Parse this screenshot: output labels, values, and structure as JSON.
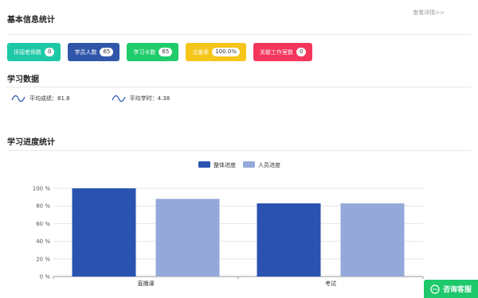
{
  "basic_info": {
    "title": "基本信息统计",
    "detail_link": "查看详情>>",
    "stats": [
      {
        "label": "评阅老师数",
        "value": "0",
        "color": "#1ec8a7"
      },
      {
        "label": "学员人数",
        "value": "65",
        "color": "#2f56a8"
      },
      {
        "label": "学习卡数",
        "value": "65",
        "color": "#1fcc6a"
      },
      {
        "label": "注册率",
        "value": "100.0%",
        "color": "#f5c518"
      },
      {
        "label": "关联工作室数",
        "value": "0",
        "color": "#f5365c"
      }
    ]
  },
  "study_data": {
    "title": "学习数据",
    "metrics": [
      {
        "label": "平均成绩：",
        "value": "81.8",
        "icon": "wave-icon"
      },
      {
        "label": "平均学时：",
        "value": "4.38",
        "icon": "wave-icon"
      }
    ]
  },
  "progress": {
    "title": "学习进度统计"
  },
  "chart_data": {
    "type": "bar",
    "categories": [
      "直播课",
      "考试"
    ],
    "series": [
      {
        "name": "整体进度",
        "values": [
          100,
          83
        ],
        "color": "#2a53b1"
      },
      {
        "name": "人员进度",
        "values": [
          88,
          83
        ],
        "color": "#94a9da"
      }
    ],
    "ylim": [
      0,
      100
    ],
    "yticks": [
      0,
      20,
      40,
      60,
      80,
      100
    ],
    "ytick_suffix": " %",
    "legend": "top-center",
    "grid": true
  },
  "service": {
    "label": "咨询客服",
    "icon": "chat-icon",
    "color": "#1ec86b"
  }
}
